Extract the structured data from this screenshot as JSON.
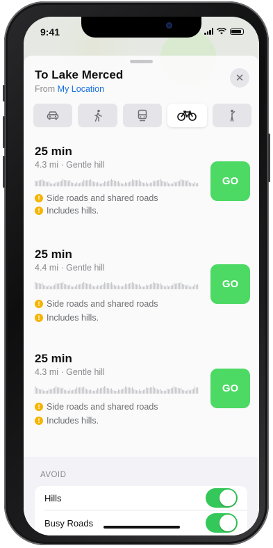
{
  "status_bar": {
    "time": "9:41"
  },
  "header": {
    "title": "To Lake Merced",
    "from_prefix": "From",
    "from_link": "My Location",
    "close_icon": "close-icon"
  },
  "modes": [
    {
      "icon": "car-icon",
      "selected": false
    },
    {
      "icon": "walk-icon",
      "selected": false
    },
    {
      "icon": "transit-icon",
      "selected": false
    },
    {
      "icon": "bicycle-icon",
      "selected": true
    },
    {
      "icon": "rideshare-icon",
      "selected": false
    }
  ],
  "routes": [
    {
      "time": "25 min",
      "meta": "4.3 mi · Gentle hill",
      "warnings": [
        "Side roads and shared roads",
        "Includes hills."
      ],
      "go_label": "GO"
    },
    {
      "time": "25 min",
      "meta": "4.4 mi · Gentle hill",
      "warnings": [
        "Side roads and shared roads",
        "Includes hills."
      ],
      "go_label": "GO"
    },
    {
      "time": "25 min",
      "meta": "4.3 mi · Gentle hill",
      "warnings": [
        "Side roads and shared roads",
        "Includes hills."
      ],
      "go_label": "GO"
    }
  ],
  "avoid": {
    "title": "AVOID",
    "options": [
      {
        "label": "Hills",
        "enabled": true
      },
      {
        "label": "Busy Roads",
        "enabled": true
      }
    ]
  },
  "colors": {
    "go": "#4cd964",
    "link": "#1a6fe0",
    "warning": "#f5b400",
    "toggle_on": "#34c759"
  }
}
